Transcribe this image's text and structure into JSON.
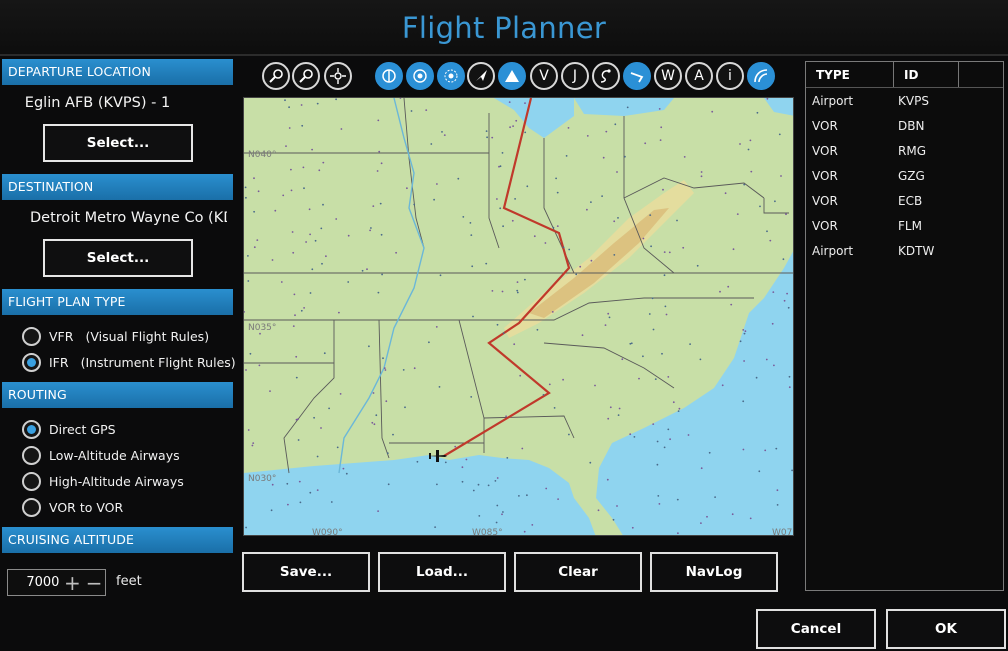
{
  "window": {
    "title": "Flight Planner"
  },
  "departure": {
    "header": "DEPARTURE LOCATION",
    "location": "Eglin AFB (KVPS) - 1",
    "select_label": "Select..."
  },
  "destination": {
    "header": "DESTINATION",
    "location": "Detroit Metro Wayne Co (KD...",
    "select_label": "Select..."
  },
  "flight_plan_type": {
    "header": "FLIGHT PLAN TYPE",
    "options": [
      {
        "label": "VFR",
        "sub": "(Visual Flight Rules)",
        "checked": false
      },
      {
        "label": "IFR",
        "sub": "(Instrument Flight Rules)",
        "checked": true
      }
    ]
  },
  "routing": {
    "header": "ROUTING",
    "options": [
      {
        "label": "Direct GPS",
        "checked": true
      },
      {
        "label": "Low-Altitude Airways",
        "checked": false
      },
      {
        "label": "High-Altitude Airways",
        "checked": false
      },
      {
        "label": "VOR to VOR",
        "checked": false
      }
    ]
  },
  "cruising_altitude": {
    "header": "CRUISING ALTITUDE",
    "value": "7000",
    "unit": "feet",
    "increment": "+",
    "decrement": "−"
  },
  "toolbar": {
    "icons": [
      {
        "name": "zoom-in-icon",
        "active": false,
        "glyph": ""
      },
      {
        "name": "zoom-out-icon",
        "active": false,
        "glyph": ""
      },
      {
        "name": "center-map-icon",
        "active": false,
        "glyph": ""
      },
      {
        "name": "airport-filter-icon",
        "active": true,
        "glyph": ""
      },
      {
        "name": "vor-filter-icon",
        "active": true,
        "glyph": ""
      },
      {
        "name": "ndb-filter-icon",
        "active": true,
        "glyph": ""
      },
      {
        "name": "aircraft-icon",
        "active": false,
        "glyph": ""
      },
      {
        "name": "waypoint-filter-icon",
        "active": true,
        "glyph": ""
      },
      {
        "name": "victor-airway-icon",
        "active": false,
        "glyph": "V"
      },
      {
        "name": "jet-airway-icon",
        "active": false,
        "glyph": "J"
      },
      {
        "name": "route-icon",
        "active": false,
        "glyph": ""
      },
      {
        "name": "flight-path-icon",
        "active": true,
        "glyph": ""
      },
      {
        "name": "weather-icon",
        "active": false,
        "glyph": "W"
      },
      {
        "name": "altitude-icon",
        "active": false,
        "glyph": "A"
      },
      {
        "name": "info-icon",
        "active": false,
        "glyph": "i"
      },
      {
        "name": "terrain-icon",
        "active": true,
        "glyph": ""
      }
    ]
  },
  "map": {
    "lat_labels": [
      "N040°",
      "N035°",
      "N030°"
    ],
    "lon_labels": [
      "W090°",
      "W085°",
      "W07"
    ],
    "route_color": "#c0392b",
    "water_color": "#8fd4ef",
    "land_color": "#c8dfa7"
  },
  "actions": {
    "save": "Save...",
    "load": "Load...",
    "clear": "Clear",
    "navlog": "NavLog",
    "cancel": "Cancel",
    "ok": "OK"
  },
  "waypoints": {
    "columns": [
      "TYPE",
      "ID"
    ],
    "rows": [
      {
        "type": "Airport",
        "id": "KVPS"
      },
      {
        "type": "VOR",
        "id": "DBN"
      },
      {
        "type": "VOR",
        "id": "RMG"
      },
      {
        "type": "VOR",
        "id": "GZG"
      },
      {
        "type": "VOR",
        "id": "ECB"
      },
      {
        "type": "VOR",
        "id": "FLM"
      },
      {
        "type": "Airport",
        "id": "KDTW"
      }
    ]
  }
}
